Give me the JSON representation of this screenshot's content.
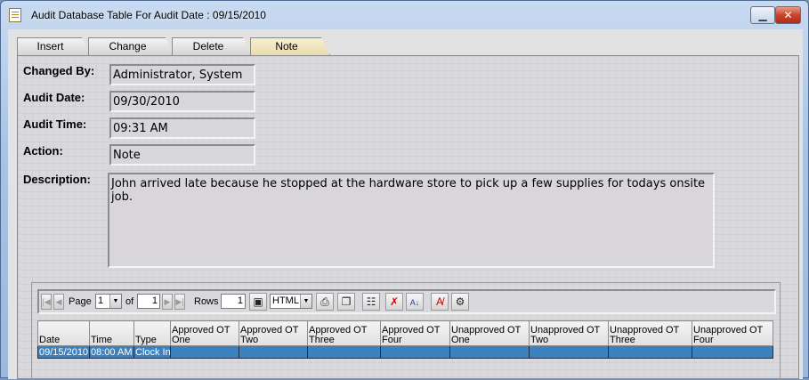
{
  "window": {
    "title": "Audit Database Table For Audit Date : 09/15/2010"
  },
  "tabs": [
    {
      "label": "Insert"
    },
    {
      "label": "Change"
    },
    {
      "label": "Delete"
    },
    {
      "label": "Note"
    }
  ],
  "form": {
    "changed_by_label": "Changed By:",
    "changed_by_value": "Administrator, System",
    "audit_date_label": "Audit Date:",
    "audit_date_value": "09/30/2010",
    "audit_time_label": "Audit Time:",
    "audit_time_value": "09:31 AM",
    "action_label": "Action:",
    "action_value": "Note",
    "description_label": "Description:",
    "description_value": "John arrived late because he stopped at the hardware store to pick up a few supplies for todays onsite job."
  },
  "pager": {
    "page_label": "Page",
    "page_value": "1",
    "of_label": "of",
    "of_value": "1",
    "rows_label": "Rows",
    "rows_value": "1",
    "format_value": "HTML"
  },
  "table": {
    "columns": [
      "Date",
      "Time",
      "Type",
      "Approved OT One",
      "Approved OT Two",
      "Approved OT Three",
      "Approved OT Four",
      "Unapproved OT One",
      "Unapproved OT Two",
      "Unapproved OT Three",
      "Unapproved OT Four"
    ],
    "rows": [
      [
        "09/15/2010",
        "08:00 AM",
        "Clock In",
        "",
        "",
        "",
        "",
        "",
        "",
        "",
        ""
      ]
    ]
  }
}
